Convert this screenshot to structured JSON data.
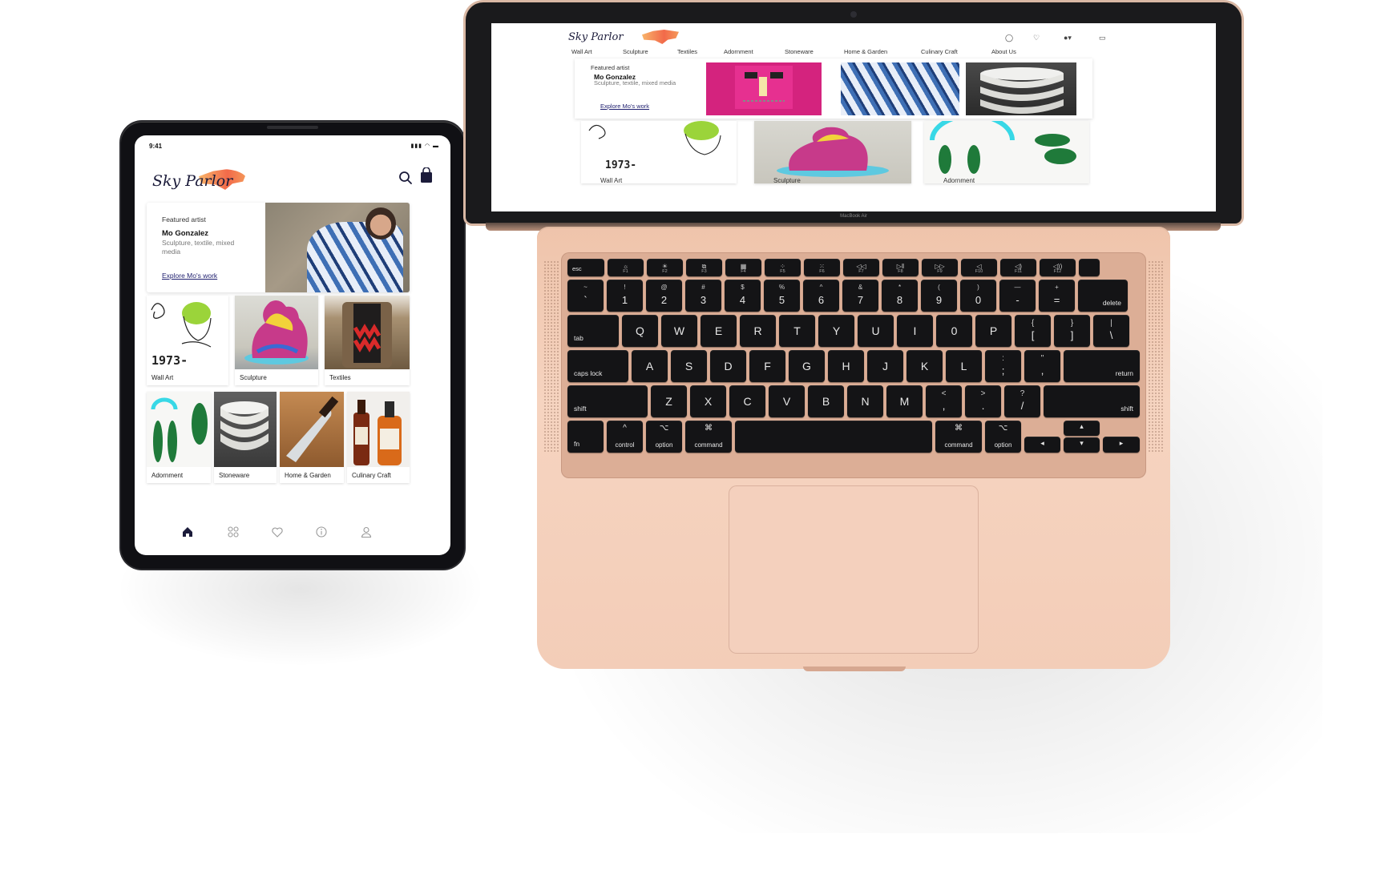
{
  "tablet": {
    "status_time": "9:41",
    "brand": "Sky Parlor",
    "featured": {
      "eyebrow": "Featured artist",
      "name": "Mo Gonzalez",
      "description": "Sculpture, textile, mixed media",
      "link": "Explore Mo's work"
    },
    "categories": [
      {
        "label": "Wall Art"
      },
      {
        "label": "Sculpture"
      },
      {
        "label": "Textiles"
      },
      {
        "label": "Adornment"
      },
      {
        "label": "Stoneware"
      },
      {
        "label": "Home & Garden"
      },
      {
        "label": "Culinary Craft"
      }
    ],
    "wall_art_text": "1973-",
    "tabbar": [
      "home-icon",
      "grid-icon",
      "heart-icon",
      "info-icon",
      "user-icon"
    ]
  },
  "laptop": {
    "brand": "Sky Parlor",
    "nav": [
      "Wall Art",
      "Sculpture",
      "Textiles",
      "Adornment",
      "Stoneware",
      "Home & Garden",
      "Culinary Craft",
      "About Us"
    ],
    "featured": {
      "eyebrow": "Featured artist",
      "name": "Mo Gonzalez",
      "description": "Sculpture, textile, mixed media",
      "link": "Explore Mo's work"
    },
    "categories": [
      "Wall Art",
      "Sculpture",
      "Adornment"
    ],
    "wall_art_text": "1973-",
    "device_label": "MacBook Air"
  },
  "keyboard": {
    "fn_row": [
      {
        "icon": "esc",
        "label": ""
      },
      {
        "icon": "☼",
        "label": "F1"
      },
      {
        "icon": "☀",
        "label": "F2"
      },
      {
        "icon": "⧉",
        "label": "F3"
      },
      {
        "icon": "▦",
        "label": "F4"
      },
      {
        "icon": "⁘",
        "label": "F5"
      },
      {
        "icon": "⁙",
        "label": "F6"
      },
      {
        "icon": "◁◁",
        "label": "F7"
      },
      {
        "icon": "▷‖",
        "label": "F8"
      },
      {
        "icon": "▷▷",
        "label": "F9"
      },
      {
        "icon": "◁",
        "label": "F10"
      },
      {
        "icon": "◁)",
        "label": "F11"
      },
      {
        "icon": "◁))",
        "label": "F12"
      },
      {
        "icon": "",
        "label": ""
      }
    ],
    "row1": [
      {
        "top": "~",
        "bot": "`"
      },
      {
        "top": "!",
        "bot": "1"
      },
      {
        "top": "@",
        "bot": "2"
      },
      {
        "top": "#",
        "bot": "3"
      },
      {
        "top": "$",
        "bot": "4"
      },
      {
        "top": "%",
        "bot": "5"
      },
      {
        "top": "^",
        "bot": "6"
      },
      {
        "top": "&",
        "bot": "7"
      },
      {
        "top": "*",
        "bot": "8"
      },
      {
        "top": "(",
        "bot": "9"
      },
      {
        "top": ")",
        "bot": "0"
      },
      {
        "top": "—",
        "bot": "-"
      },
      {
        "top": "+",
        "bot": "="
      }
    ],
    "delete": "delete",
    "tab": "tab",
    "row2": [
      "Q",
      "W",
      "E",
      "R",
      "T",
      "Y",
      "U",
      "I",
      "0",
      "P"
    ],
    "row2_sym": [
      {
        "top": "{",
        "bot": "["
      },
      {
        "top": "}",
        "bot": "]"
      },
      {
        "top": "|",
        "bot": "\\"
      }
    ],
    "caps": "caps lock",
    "row3": [
      "A",
      "S",
      "D",
      "F",
      "G",
      "H",
      "J",
      "K",
      "L"
    ],
    "row3_sym": [
      {
        "top": ":",
        "bot": ";"
      },
      {
        "top": "\"",
        "bot": ","
      }
    ],
    "return": "return",
    "shift": "shift",
    "row4": [
      "Z",
      "X",
      "C",
      "V",
      "B",
      "N",
      "M"
    ],
    "row4_sym": [
      {
        "top": "<",
        "bot": ","
      },
      {
        "top": ">",
        "bot": "."
      },
      {
        "top": "?",
        "bot": "/"
      }
    ],
    "fn": "fn",
    "control": "control",
    "option": "option",
    "command": "command",
    "control_icon": "^",
    "option_icon": "⌥",
    "command_icon": "⌘",
    "arrows": {
      "left": "◂",
      "up": "▴",
      "down": "▾",
      "right": "▸"
    }
  },
  "colors": {
    "brand_navy": "#1b1b3a",
    "laptop_gold": "#f6d4c0",
    "logo_orange": "#f26a4a"
  }
}
